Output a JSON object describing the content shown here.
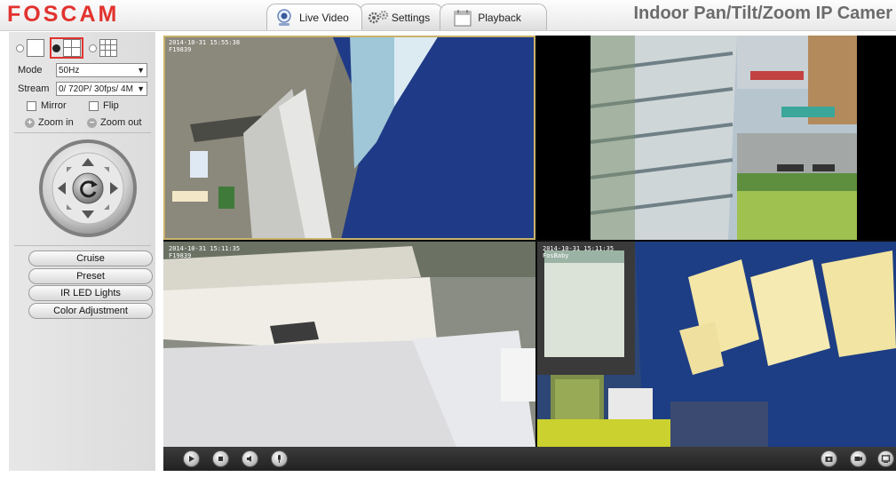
{
  "brand": {
    "logo_text": "FOSCAM",
    "logo_color": "#e2332f"
  },
  "header": {
    "tabs": [
      {
        "label": "Live Video",
        "icon": "camera-icon",
        "active": true
      },
      {
        "label": "Settings",
        "icon": "gears-icon",
        "active": false
      },
      {
        "label": "Playback",
        "icon": "calendar-icon",
        "active": false
      }
    ],
    "camera_title": "Indoor Pan/Tilt/Zoom IP Camer"
  },
  "panel": {
    "layouts": [
      {
        "name": "single-view",
        "selected": false
      },
      {
        "name": "quad-view",
        "selected": true
      },
      {
        "name": "nine-view",
        "selected": false
      }
    ],
    "mode": {
      "label": "Mode",
      "value": "50Hz"
    },
    "stream": {
      "label": "Stream",
      "value": "0/ 720P/ 30fps/ 4M"
    },
    "mirror_label": "Mirror",
    "flip_label": "Flip",
    "zoom_in_label": "Zoom in",
    "zoom_out_label": "Zoom out",
    "buttons": {
      "cruise": "Cruise",
      "preset": "Preset",
      "ir_led": "IR LED Lights",
      "color_adjust": "Color Adjustment"
    }
  },
  "video": {
    "cells": [
      {
        "osd_date": "2014-10-31 15:55:38",
        "osd_name": "F19839"
      },
      {
        "osd_date": "",
        "osd_name": ""
      },
      {
        "osd_date": "2014-10-31 15:11:35",
        "osd_name": "F19839"
      },
      {
        "osd_date": "2014-10-31 15:11:35",
        "osd_name": "FosBaby"
      }
    ]
  },
  "toolbar": {
    "left_icons": [
      "play-icon",
      "stop-icon",
      "audio-icon",
      "talk-icon"
    ],
    "right_icons": [
      "snapshot-icon",
      "record-icon",
      "fullscreen-icon"
    ]
  },
  "colors": {
    "accent_red": "#e2332f",
    "selection_outline": "#c9b26a",
    "toolbar_bg": "#2a2a2a"
  }
}
